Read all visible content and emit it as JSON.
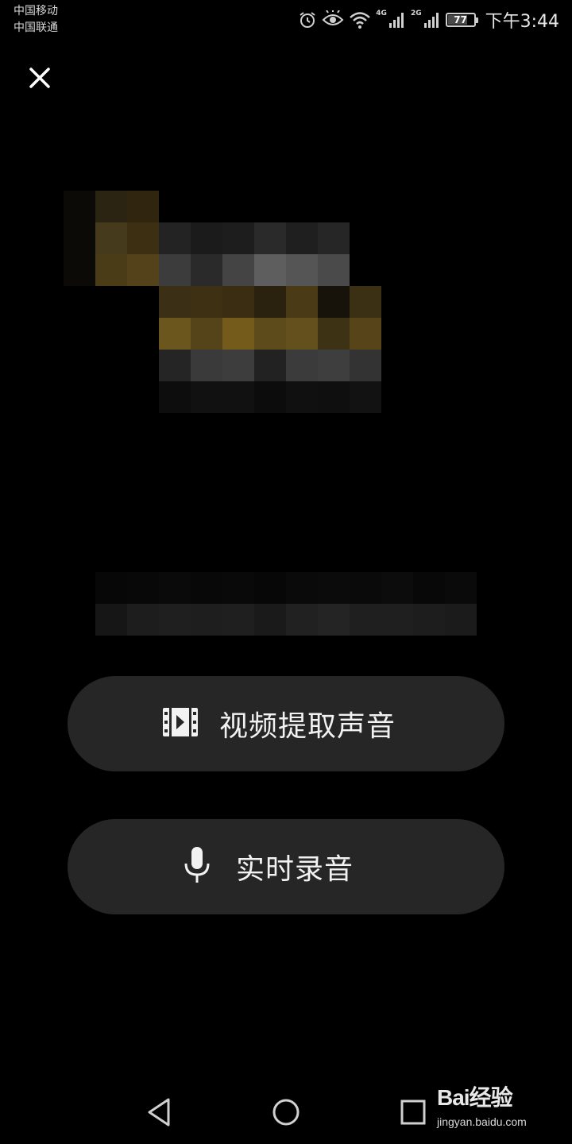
{
  "status_bar": {
    "carrier_1": "中国移动",
    "carrier_2": "中国联通",
    "net_label_1": "4G",
    "net_label_2": "2G",
    "battery_level": 77,
    "battery_text": "77",
    "time": "下午3:44",
    "icons": [
      "alarm-icon",
      "eye-icon",
      "wifi-icon",
      "signal-4g-icon",
      "signal-2g-icon",
      "battery-icon"
    ]
  },
  "header": {
    "close_icon": "close-icon"
  },
  "actions": {
    "extract_audio": {
      "label": "视频提取声音",
      "icon": "film-icon"
    },
    "live_record": {
      "label": "实时录音",
      "icon": "microphone-icon"
    }
  },
  "nav": {
    "back_icon": "back-triangle-icon",
    "home_icon": "home-circle-icon",
    "recent_icon": "recent-square-icon"
  },
  "watermark": {
    "logo_text": "Bai经验",
    "url": "jingyan.baidu.com"
  },
  "colors": {
    "background": "#000000",
    "button_bg": "#262626",
    "text": "#f2f2f2",
    "accent_mosaic": "#6b561e"
  }
}
